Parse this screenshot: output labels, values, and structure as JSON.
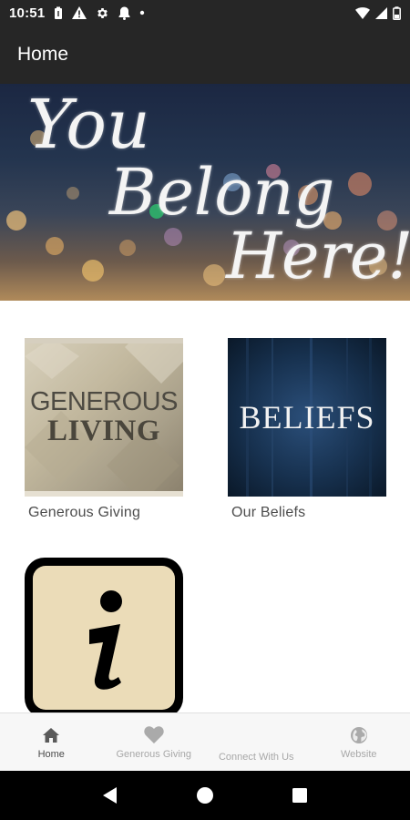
{
  "status_bar": {
    "time": "10:51",
    "left_icons": [
      "battery-saver-icon",
      "alert-icon",
      "settings-icon",
      "notification-icon",
      "dot-icon"
    ],
    "right_icons": [
      "wifi-icon",
      "cellular-icon",
      "battery-icon"
    ]
  },
  "app_bar": {
    "title": "Home"
  },
  "hero": {
    "line1": "You",
    "line2": "Belong",
    "line3": "Here!"
  },
  "tiles": [
    {
      "label": "Generous Giving",
      "image_text_1": "GENEROUS",
      "image_text_2": "LIVING"
    },
    {
      "label": "Our Beliefs",
      "image_text": "BELIEFS"
    },
    {
      "icon": "info-icon"
    }
  ],
  "bottom_nav": {
    "items": [
      {
        "label": "Home",
        "icon": "home-icon",
        "active": true
      },
      {
        "label": "Generous Giving",
        "icon": "heart-icon",
        "active": false
      },
      {
        "label": "Connect With Us",
        "icon": "",
        "active": false
      },
      {
        "label": "Website",
        "icon": "globe-icon",
        "active": false
      }
    ]
  },
  "colors": {
    "app_bar": "#262626",
    "nav_background": "#f7f7f7",
    "nav_active": "#4a4a4a",
    "nav_inactive": "#a8a8a8"
  }
}
